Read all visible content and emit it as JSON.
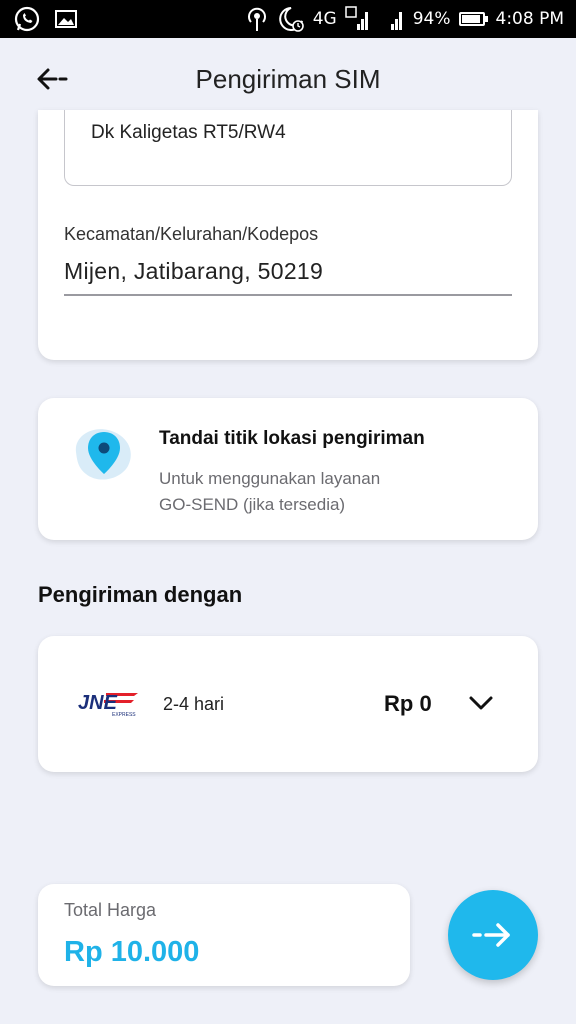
{
  "status_bar": {
    "network": "4G",
    "sim1": "1",
    "sim2": "2",
    "battery_percent": "94%",
    "battery_level": 0.94,
    "time": "4:08 PM",
    "icons": [
      "whatsapp-icon",
      "gallery-icon",
      "hotspot-icon",
      "night-alarm-icon",
      "signal-icon",
      "battery-icon"
    ]
  },
  "header": {
    "title": "Pengiriman SIM",
    "back_icon": "arrow-left-icon"
  },
  "address": {
    "street": "Dk Kaligetas RT5/RW4",
    "district_label": "Kecamatan/Kelurahan/Kodepos",
    "district_value": "Mijen, Jatibarang, 50219"
  },
  "location": {
    "title": "Tandai titik lokasi pengiriman",
    "subtitle_line1": "Untuk menggunakan layanan",
    "subtitle_line2": "GO-SEND (jika tersedia)",
    "icon": "map-pin-icon"
  },
  "shipping": {
    "section_title": "Pengiriman dengan",
    "courier_logo": "JNE",
    "courier_logo_sub": "EXPRESS",
    "duration": "2-4 hari",
    "price": "Rp 0",
    "icon": "chevron-down-icon"
  },
  "total": {
    "label": "Total Harga",
    "value": "Rp 10.000"
  },
  "colors": {
    "accent": "#1fb8ec",
    "background": "#eef0f8",
    "jne_blue": "#1b2f7a",
    "jne_red": "#e3202a"
  }
}
